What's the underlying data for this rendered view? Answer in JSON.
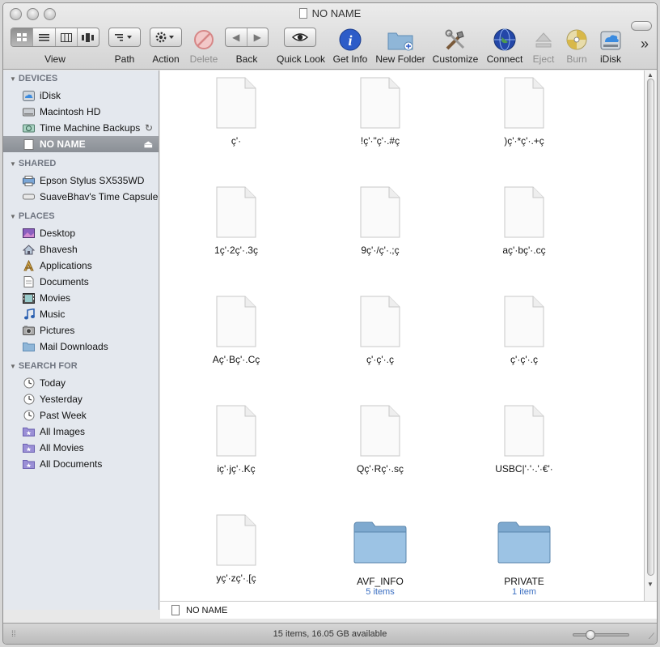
{
  "window": {
    "title": "NO NAME"
  },
  "toolbar": {
    "view_label": "View",
    "path_label": "Path",
    "action_label": "Action",
    "delete_label": "Delete",
    "back_label": "Back",
    "quicklook_label": "Quick Look",
    "getinfo_label": "Get Info",
    "newfolder_label": "New Folder",
    "customize_label": "Customize",
    "connect_label": "Connect",
    "eject_label": "Eject",
    "burn_label": "Burn",
    "idisk_label": "iDisk",
    "overflow_label": "»",
    "selected_view": "icon"
  },
  "sidebar": {
    "devices_header": "DEVICES",
    "shared_header": "SHARED",
    "places_header": "PLACES",
    "search_header": "SEARCH FOR",
    "devices": [
      {
        "label": "iDisk",
        "icon": "idisk-icon"
      },
      {
        "label": "Macintosh HD",
        "icon": "hard-drive-icon"
      },
      {
        "label": "Time Machine Backups",
        "icon": "time-machine-drive-icon",
        "right": "↻"
      },
      {
        "label": "NO NAME",
        "icon": "removable-drive-icon",
        "right": "⏏",
        "selected": true
      }
    ],
    "shared": [
      {
        "label": "Epson Stylus SX535WD",
        "icon": "printer-icon"
      },
      {
        "label": "SuaveBhav's Time Capsule",
        "icon": "time-capsule-icon"
      }
    ],
    "places": [
      {
        "label": "Desktop",
        "icon": "desktop-icon"
      },
      {
        "label": "Bhavesh",
        "icon": "home-icon"
      },
      {
        "label": "Applications",
        "icon": "applications-icon"
      },
      {
        "label": "Documents",
        "icon": "documents-icon"
      },
      {
        "label": "Movies",
        "icon": "movies-icon"
      },
      {
        "label": "Music",
        "icon": "music-icon"
      },
      {
        "label": "Pictures",
        "icon": "pictures-icon"
      },
      {
        "label": "Mail Downloads",
        "icon": "folder-icon"
      }
    ],
    "search": [
      {
        "label": "Today",
        "icon": "clock-icon"
      },
      {
        "label": "Yesterday",
        "icon": "clock-icon"
      },
      {
        "label": "Past Week",
        "icon": "clock-icon"
      },
      {
        "label": "All Images",
        "icon": "smart-folder-icon"
      },
      {
        "label": "All Movies",
        "icon": "smart-folder-icon"
      },
      {
        "label": "All Documents",
        "icon": "smart-folder-icon"
      }
    ]
  },
  "files": [
    {
      "name": "ç'·",
      "kind": "document",
      "sub": ""
    },
    {
      "name": "!ç'·\"ç'·.#ç",
      "kind": "document",
      "sub": ""
    },
    {
      "name": ")ç'·*ç'·.+ç",
      "kind": "document",
      "sub": ""
    },
    {
      "name": "1ç'·2ç'·.3ç",
      "kind": "document",
      "sub": ""
    },
    {
      "name": "9ç'·/ç'·.;ç",
      "kind": "document",
      "sub": ""
    },
    {
      "name": "aç'·bç'·.cç",
      "kind": "document",
      "sub": ""
    },
    {
      "name": "Aç'·Bç'·.Cç",
      "kind": "document",
      "sub": ""
    },
    {
      "name": "ç'·ç'·.ç",
      "kind": "document",
      "sub": ""
    },
    {
      "name": "ç'·ç'·.ç",
      "kind": "document",
      "sub": ""
    },
    {
      "name": "iç'·jç'·.Kç",
      "kind": "document",
      "sub": ""
    },
    {
      "name": "Qç'·Rç'·.sç",
      "kind": "document",
      "sub": ""
    },
    {
      "name": "USBC|'·'·.'·€'·",
      "kind": "document",
      "sub": ""
    },
    {
      "name": "yç'·zç'·.[ç",
      "kind": "document",
      "sub": ""
    },
    {
      "name": "AVF_INFO",
      "kind": "folder",
      "sub": "5 items"
    },
    {
      "name": "PRIVATE",
      "kind": "folder",
      "sub": "1 item"
    }
  ],
  "pathbar": {
    "label": "NO NAME"
  },
  "status": {
    "text": "15 items, 16.05 GB available",
    "zoom_fraction": 0.25
  },
  "colors": {
    "selection": "#8a8f96",
    "folder": "#8fb6d8",
    "link": "#3b6fc2"
  }
}
